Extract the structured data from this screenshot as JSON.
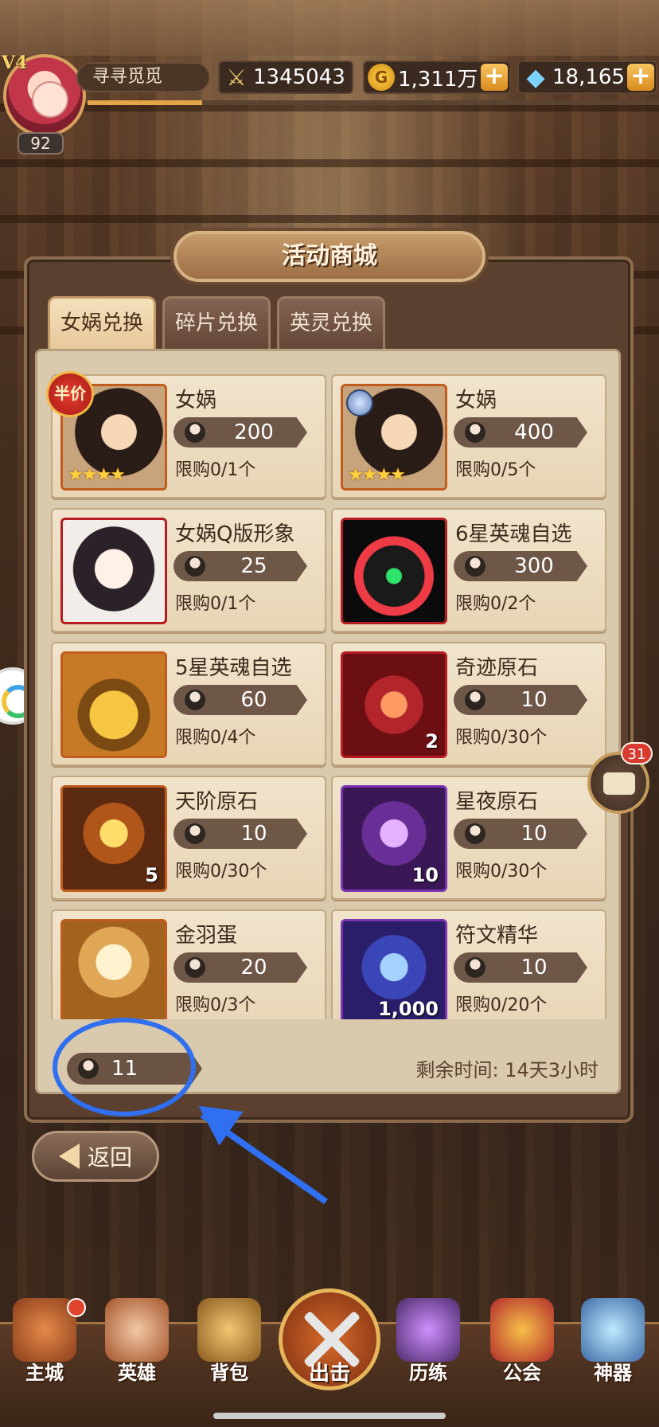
{
  "header": {
    "vip_label": "V4",
    "player_name": "寻寻觅觅",
    "level": "92",
    "exp_fraction": 0.2,
    "power": "1345043",
    "gold": "1,311万",
    "diamonds": "18,165",
    "plus_label": "+"
  },
  "shop": {
    "title": "活动商城",
    "tabs": [
      {
        "label": "女娲兑换",
        "active": true
      },
      {
        "label": "碎片兑换",
        "active": false
      },
      {
        "label": "英灵兑换",
        "active": false
      }
    ],
    "items": [
      {
        "name": "女娲",
        "price": "200",
        "limit": "限购0/1个",
        "tag": "半价",
        "stars": "★★★★"
      },
      {
        "name": "女娲",
        "price": "400",
        "limit": "限购0/5个",
        "stars": "★★★★"
      },
      {
        "name": "女娲Q版形象",
        "price": "25",
        "limit": "限购0/1个"
      },
      {
        "name": "6星英魂自选",
        "price": "300",
        "limit": "限购0/2个"
      },
      {
        "name": "5星英魂自选",
        "price": "60",
        "limit": "限购0/4个"
      },
      {
        "name": "奇迹原石",
        "price": "10",
        "limit": "限购0/30个",
        "count": "2"
      },
      {
        "name": "天阶原石",
        "price": "10",
        "limit": "限购0/30个",
        "count": "5"
      },
      {
        "name": "星夜原石",
        "price": "10",
        "limit": "限购0/30个",
        "count": "10"
      },
      {
        "name": "金羽蛋",
        "price": "20",
        "limit": "限购0/3个"
      },
      {
        "name": "符文精华",
        "price": "10",
        "limit": "限购0/20个",
        "count": "1,000"
      }
    ],
    "owned_currency": "11",
    "remaining_time": "剩余时间: 14天3小时"
  },
  "back_label": "返回",
  "chat_badge": "31",
  "bottom_nav": [
    {
      "label": "主城"
    },
    {
      "label": "英雄"
    },
    {
      "label": "背包"
    },
    {
      "label": "出击"
    },
    {
      "label": "历练"
    },
    {
      "label": "公会"
    },
    {
      "label": "神器"
    }
  ],
  "colors": {
    "annotation": "#2f6ff0",
    "accent_gold": "#e4a447"
  }
}
